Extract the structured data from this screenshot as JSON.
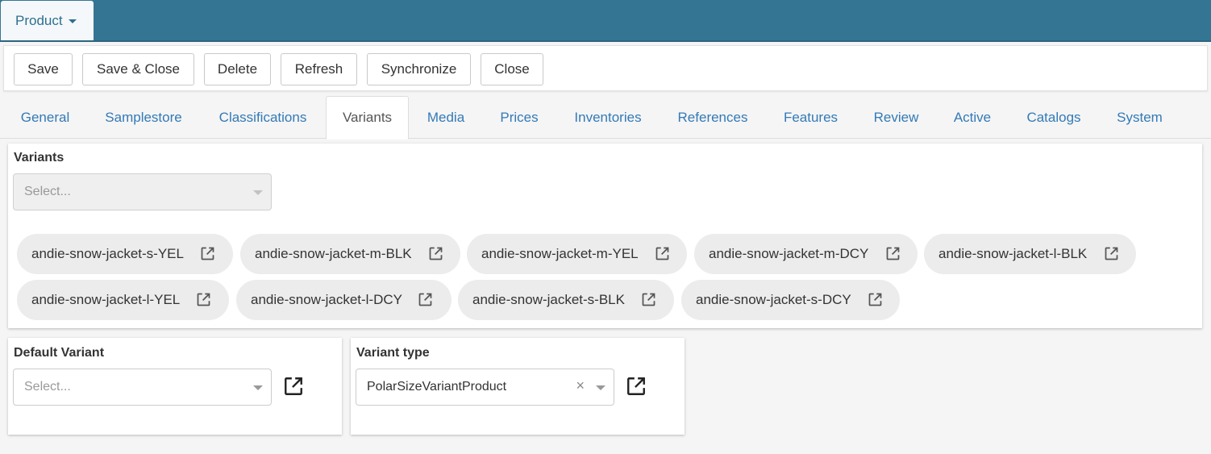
{
  "header": {
    "product_label": "Product"
  },
  "toolbar": {
    "save": "Save",
    "save_close": "Save & Close",
    "delete": "Delete",
    "refresh": "Refresh",
    "synchronize": "Synchronize",
    "close": "Close"
  },
  "tabs": [
    {
      "label": "General"
    },
    {
      "label": "Samplestore"
    },
    {
      "label": "Classifications"
    },
    {
      "label": "Variants",
      "active": true
    },
    {
      "label": "Media"
    },
    {
      "label": "Prices"
    },
    {
      "label": "Inventories"
    },
    {
      "label": "References"
    },
    {
      "label": "Features"
    },
    {
      "label": "Review"
    },
    {
      "label": "Active"
    },
    {
      "label": "Catalogs"
    },
    {
      "label": "System"
    }
  ],
  "variants": {
    "label": "Variants",
    "select_placeholder": "Select...",
    "chips": [
      "andie-snow-jacket-s-YEL",
      "andie-snow-jacket-m-BLK",
      "andie-snow-jacket-m-YEL",
      "andie-snow-jacket-m-DCY",
      "andie-snow-jacket-l-BLK",
      "andie-snow-jacket-l-YEL",
      "andie-snow-jacket-l-DCY",
      "andie-snow-jacket-s-BLK",
      "andie-snow-jacket-s-DCY"
    ]
  },
  "default_variant": {
    "label": "Default Variant",
    "placeholder": "Select..."
  },
  "variant_type": {
    "label": "Variant type",
    "value": "PolarSizeVariantProduct",
    "clear_symbol": "×"
  },
  "icons": {
    "external_link": "external-link-icon",
    "dropdown": "chevron-down-icon"
  },
  "colors": {
    "header_bg": "#357594",
    "link": "#337ab7",
    "chip_bg": "#ececec"
  }
}
